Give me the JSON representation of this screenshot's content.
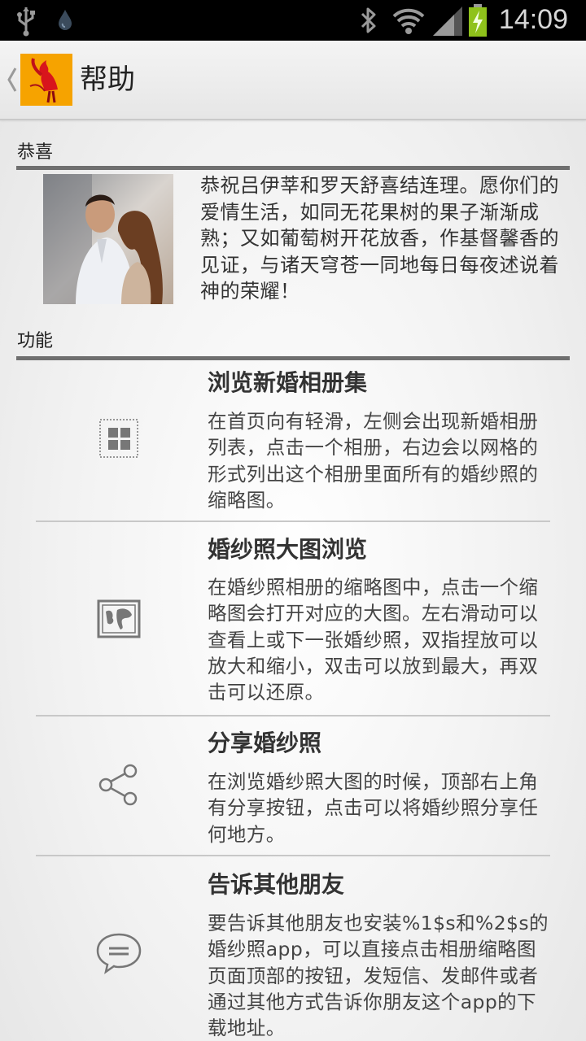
{
  "status_bar": {
    "time": "14:09",
    "icons": [
      "usb-icon",
      "droplet-icon",
      "bluetooth-icon",
      "wifi-icon",
      "signal-icon",
      "battery-charging-icon"
    ]
  },
  "action_bar": {
    "title": "帮助",
    "back_icon": "chevron-left-icon",
    "logo": "app-logo"
  },
  "sections": {
    "congrats": {
      "header": "恭喜",
      "text": "恭祝吕伊莘和罗天舒喜结连理。愿你们的爱情生活，如同无花果树的果子渐渐成熟；又如葡萄树开花放香，作基督馨香的见证，与诸天穹苍一同地每日每夜述说着神的荣耀！"
    },
    "features": {
      "header": "功能",
      "items": [
        {
          "icon": "grid-icon",
          "title": "浏览新婚相册集",
          "desc": "在首页向有轻滑，左侧会出现新婚相册列表，点击一个相册，右边会以网格的形式列出这个相册里面所有的婚纱照的缩略图。"
        },
        {
          "icon": "map-picture-icon",
          "title": "婚纱照大图浏览",
          "desc": "在婚纱照相册的缩略图中，点击一个缩略图会打开对应的大图。左右滑动可以查看上或下一张婚纱照，双指捏放可以放大和缩小，双击可以放到最大，再双击可以还原。"
        },
        {
          "icon": "share-icon",
          "title": "分享婚纱照",
          "desc": "在浏览婚纱照大图的时候，顶部右上角有分享按钮，点击可以将婚纱照分享任何地方。"
        },
        {
          "icon": "chat-bubble-icon",
          "title": "告诉其他朋友",
          "desc": "要告诉其他朋友也安装%1$s和%2$s的婚纱照app，可以直接点击相册缩略图页面顶部的按钮，发短信、发邮件或者通过其他方式告诉你朋友这个app的下载地址。"
        }
      ]
    }
  }
}
